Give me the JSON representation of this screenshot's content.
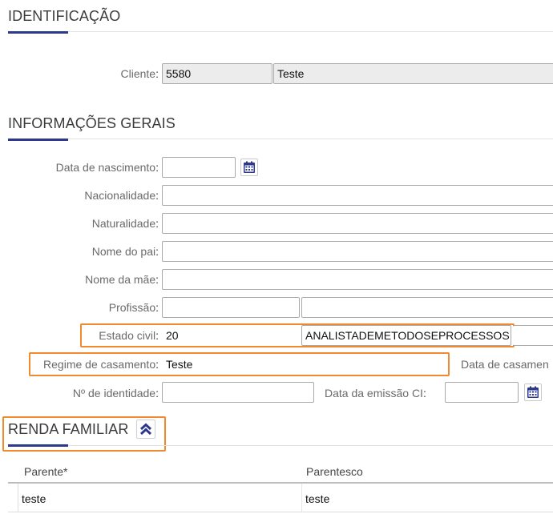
{
  "identificacao": {
    "title": "IDENTIFICAÇÃO",
    "cliente_label": "Cliente",
    "cliente_codigo": "5580",
    "cliente_nome": "Teste"
  },
  "informacoes_gerais": {
    "title": "INFORMAÇÕES GERAIS",
    "data_nascimento_label": "Data de nascimento",
    "data_nascimento_value": "",
    "nacionalidade_label": "Nacionalidade",
    "nacionalidade_value": "",
    "naturalidade_label": "Naturalidade",
    "naturalidade_value": "",
    "nome_pai_label": "Nome do pai",
    "nome_pai_value": "",
    "nome_mae_label": "Nome da mãe",
    "nome_mae_value": "",
    "profissao_label": "Profissão",
    "profissao_codigo": "",
    "profissao_descricao": "",
    "estado_civil_label": "Estado civil",
    "estado_civil_codigo": "20",
    "estado_civil_descricao": "ANALISTADEMETODOSEPROCESSOS",
    "regime_casamento_label": "Regime de casamento",
    "regime_casamento_value": "Teste",
    "data_casamento_label": "Data de casamen",
    "identidade_label": "Nº de identidade",
    "identidade_value": "",
    "data_emissao_label": "Data da emissão CI",
    "data_emissao_value": "",
    "colon": ":"
  },
  "renda_familiar": {
    "title": "RENDA FAMILIAR",
    "columns": [
      "Parente*",
      "Parentesco"
    ],
    "rows": [
      [
        "teste",
        "teste"
      ]
    ]
  },
  "icons": {
    "calendar": "calendar-icon",
    "collapse": "chevron-double-up-icon"
  },
  "colors": {
    "accent": "#2d3a8c",
    "highlight": "#f08a2c"
  }
}
